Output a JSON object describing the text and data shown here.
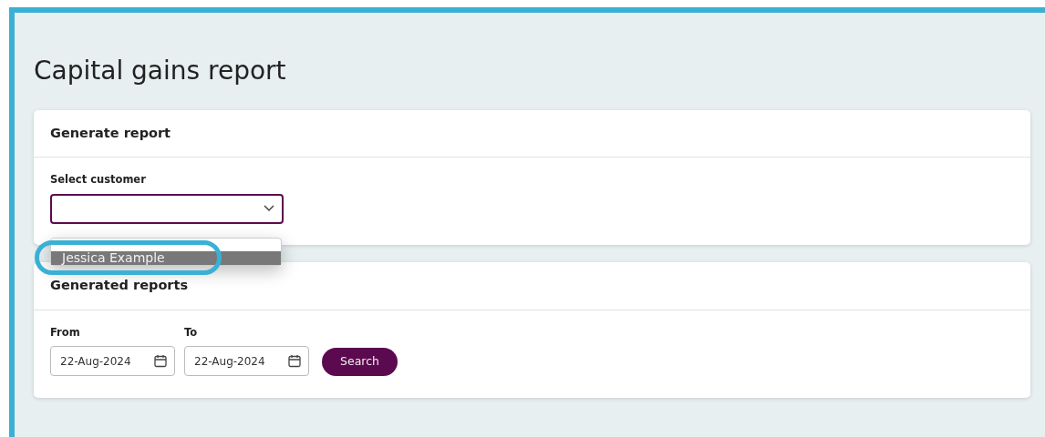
{
  "page": {
    "title": "Capital gains report"
  },
  "generate_card": {
    "title": "Generate report",
    "select_label": "Select customer",
    "dropdown": {
      "expanded": true,
      "options": [
        {
          "label": "Jessica Example",
          "selected": true,
          "highlighted": true
        }
      ]
    }
  },
  "reports_card": {
    "title": "Generated reports",
    "fields": [
      {
        "label": "From",
        "value": "22-Aug-2024"
      },
      {
        "label": "To",
        "value": "22-Aug-2024"
      }
    ],
    "button": "Search"
  }
}
